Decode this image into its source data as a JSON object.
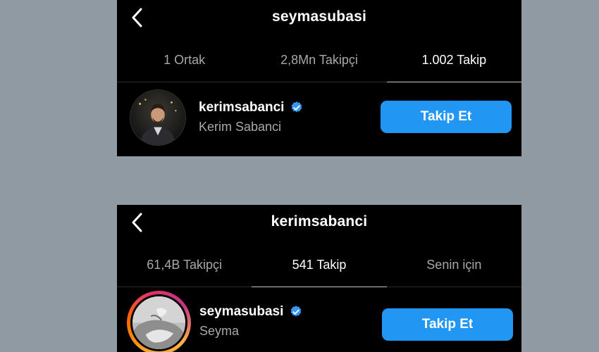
{
  "panels": [
    {
      "title": "seymasubasi",
      "tabs": [
        "1 Ortak",
        "2,8Mn Takipçi",
        "1.002 Takip"
      ],
      "active_tab": 2,
      "row": {
        "username": "kerimsabanci",
        "full_name": "Kerim Sabanci",
        "verified": true,
        "button": "Takip Et"
      }
    },
    {
      "title": "kerimsabanci",
      "tabs": [
        "61,4B Takipçi",
        "541 Takip",
        "Senin için"
      ],
      "active_tab": 1,
      "row": {
        "username": "seymasubasi",
        "full_name": "Seyma",
        "verified": true,
        "button": "Takip Et",
        "story_ring": true
      }
    }
  ],
  "colors": {
    "background": "#8f9aa3",
    "panel": "#000000",
    "button": "#2196f3",
    "verified": "#3797f0",
    "muted_text": "#a8a8a8"
  }
}
